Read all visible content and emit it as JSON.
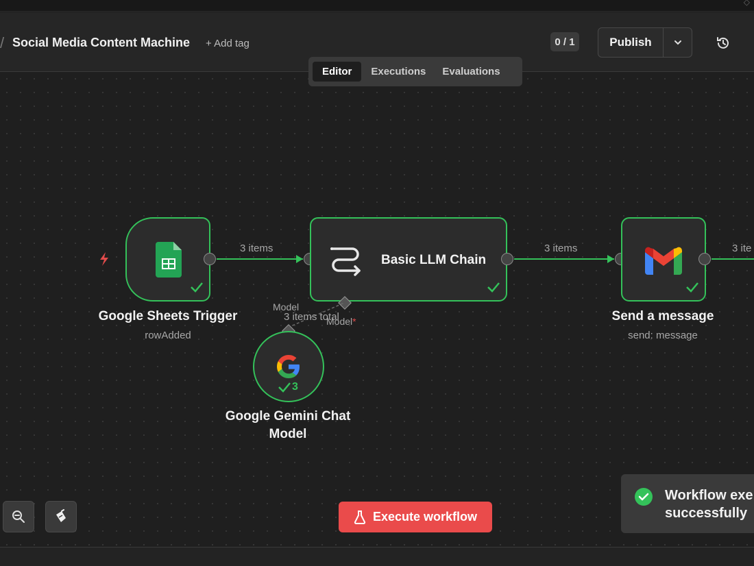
{
  "header": {
    "workflow_name": "Social Media Content Machine",
    "add_tag_label": "+ Add tag",
    "counter": "0 / 1",
    "publish_label": "Publish"
  },
  "tabs": [
    {
      "label": "Editor",
      "active": true
    },
    {
      "label": "Executions",
      "active": false
    },
    {
      "label": "Evaluations",
      "active": false
    }
  ],
  "nodes": {
    "sheets_trigger": {
      "title": "Google Sheets Trigger",
      "subtitle": "rowAdded",
      "icon": "google-sheets-icon"
    },
    "llm_chain": {
      "title": "Basic LLM Chain",
      "icon": "llm-chain-icon",
      "model_port_label": "Model"
    },
    "gmail": {
      "title": "Send a message",
      "subtitle": "send: message",
      "icon": "gmail-icon"
    },
    "gemini": {
      "title_line1": "Google Gemini Chat",
      "title_line2": "Model",
      "icon": "google-g-icon",
      "run_count": "3"
    }
  },
  "edges": {
    "trigger_to_chain": "3 items",
    "chain_to_gmail": "3 items",
    "gmail_out": "3 ite",
    "model_connection_label": "Model",
    "model_items_total": "3 items total"
  },
  "toolbar": {
    "execute_label": "Execute workflow"
  },
  "toast": {
    "line1": "Workflow exe",
    "line2": "successfully"
  },
  "colors": {
    "accent_green": "#34c25a",
    "execute_red": "#ea4b4b",
    "canvas_bg": "#1f1f1f"
  }
}
